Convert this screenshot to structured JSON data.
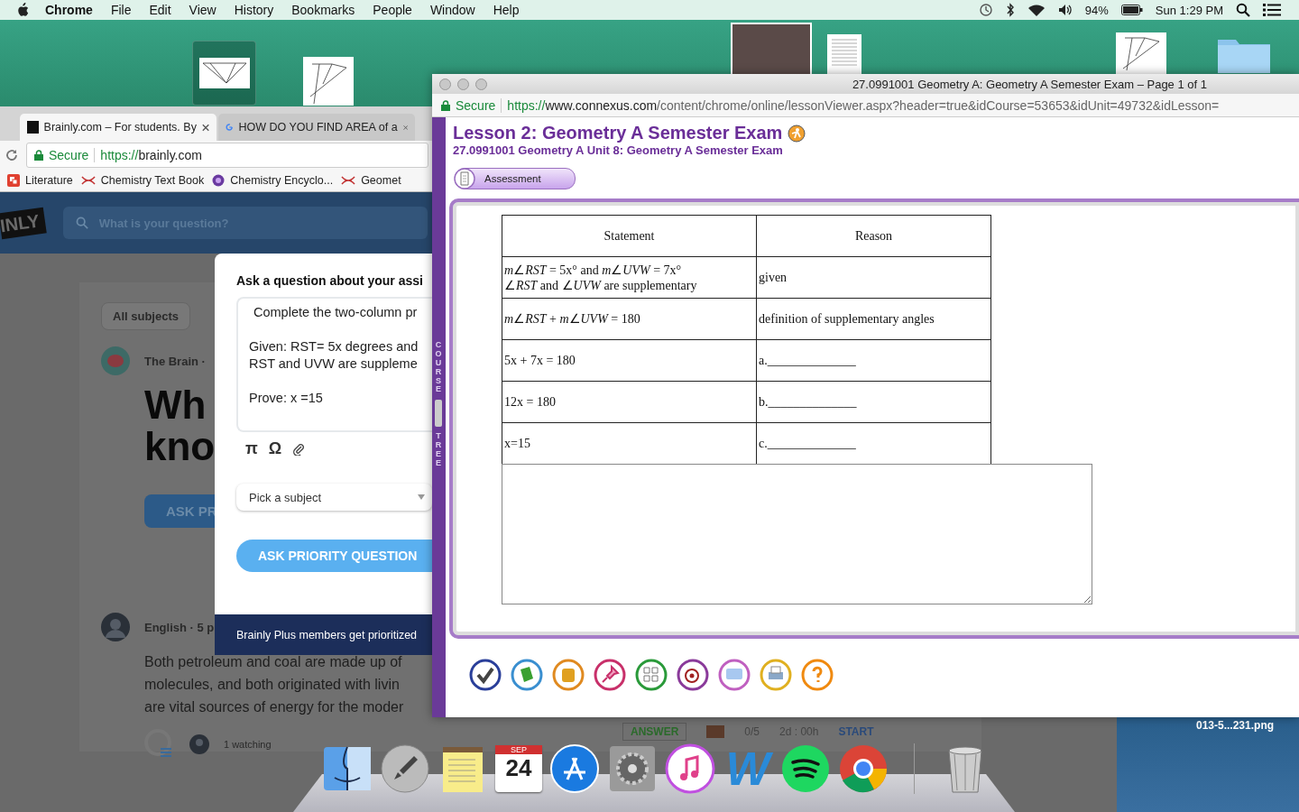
{
  "menu_bar": {
    "app": "Chrome",
    "menus": [
      "File",
      "Edit",
      "View",
      "History",
      "Bookmarks",
      "People",
      "Window",
      "Help"
    ],
    "battery": "94%",
    "clock": "Sun 1:29 PM"
  },
  "desktop": {
    "file_label": "013-5...231.png"
  },
  "brainly_window": {
    "tabs": [
      {
        "title": "Brainly.com – For students. By",
        "selected": true
      },
      {
        "title": "HOW DO YOU FIND AREA of a",
        "selected": false
      }
    ],
    "secure": "Secure",
    "url_scheme": "https://",
    "url_host": "brainly.com",
    "bookmarks": [
      {
        "label": "Literature",
        "kind": "square"
      },
      {
        "label": "Chemistry Text Book",
        "kind": "cross"
      },
      {
        "label": "Chemistry Encyclo...",
        "kind": "go"
      },
      {
        "label": "Geomet",
        "kind": "cross"
      }
    ],
    "logo": "INLY",
    "search_placeholder": "What is your question?",
    "page": {
      "subject_filter": "All subjects",
      "author": "The Brain ·",
      "heading_lines": [
        "Wh",
        "kno"
      ],
      "ask_button": "ASK PR",
      "post_meta": "English · 5 p",
      "post_lines": [
        "Both petroleum and coal are made up of",
        "molecules, and both originated with livin",
        "are vital sources of energy for the moder"
      ],
      "watching": "1 watching",
      "answer_button": "ANSWER",
      "points": "0/5",
      "time_left": "2d : 00h",
      "start": "START"
    },
    "modal": {
      "title": "Ask a question about your assi",
      "question_paragraphs": [
        [
          "Complete the two-column pr"
        ],
        [
          "Given: RST= 5x degrees and",
          "RST and UVW are suppleme"
        ],
        [
          "Prove: x =15"
        ]
      ],
      "tools": [
        "π",
        "Ω"
      ],
      "subject_select": "Pick a subject",
      "submit": "ASK PRIORITY QUESTION",
      "footer": "Brainly Plus members get prioritized"
    }
  },
  "exam_window": {
    "title": "27.0991001 Geometry A: Geometry A Semester Exam – Page 1 of 1",
    "secure": "Secure",
    "url_scheme": "https://",
    "url_host": "www.connexus.com",
    "url_path": "/content/chrome/online/lessonViewer.aspx?header=true&idCourse=53653&idUnit=49732&idLesson=",
    "lesson_title": "Lesson 2: Geometry A Semester Exam",
    "breadcrumb": "27.0991001 Geometry A  Unit 8: Geometry A Semester Exam",
    "tab": "Assessment",
    "side_tab": [
      "COURSE",
      "TREE"
    ],
    "table": {
      "columns": [
        "Statement",
        "Reason"
      ],
      "rows": [
        {
          "statement": [
            "*m*∠*RST* = 5x° and *m*∠*UVW* = 7x°",
            "∠*RST* and ∠*UVW* are supplementary"
          ],
          "reason": "given"
        },
        {
          "statement": [
            "*m*∠*RST* + *m*∠*UVW* = 180"
          ],
          "reason": "definition of supplementary angles"
        },
        {
          "statement": [
            "5x + 7x = 180"
          ],
          "reason": "a.______________"
        },
        {
          "statement": [
            "12x = 180"
          ],
          "reason": "b.______________"
        },
        {
          "statement": [
            "x=15"
          ],
          "reason": "c.______________"
        }
      ]
    }
  },
  "dock": {
    "calendar_month": "SEP",
    "calendar_day": "24",
    "word_letter": "W"
  }
}
